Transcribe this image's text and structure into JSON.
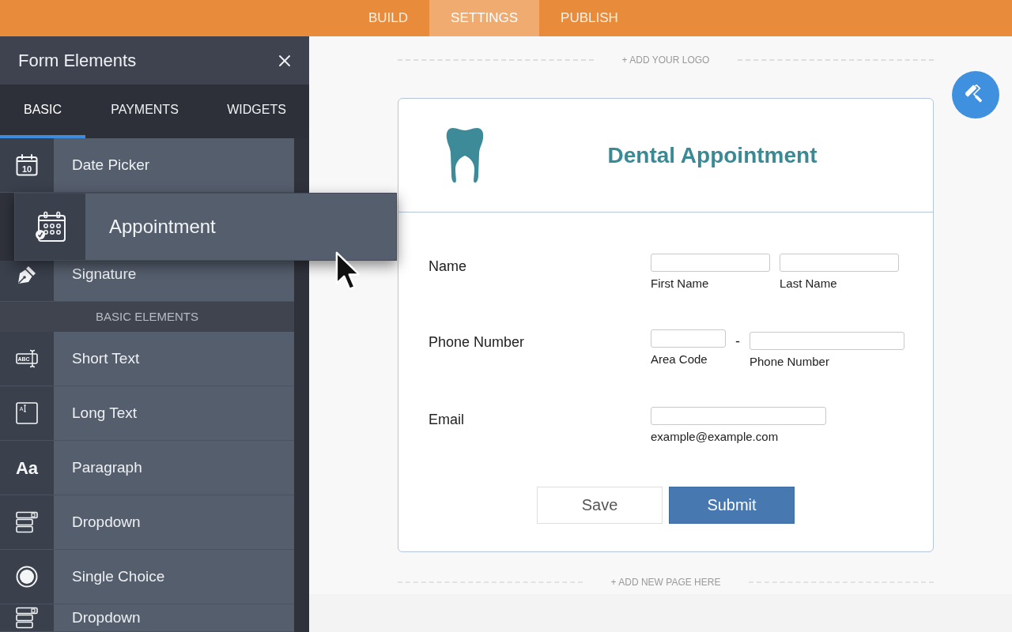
{
  "top_nav": {
    "tabs": [
      {
        "label": "BUILD",
        "selected": false
      },
      {
        "label": "SETTINGS",
        "selected": true
      },
      {
        "label": "PUBLISH",
        "selected": false
      }
    ]
  },
  "sidebar": {
    "title": "Form Elements",
    "tabs": [
      {
        "label": "BASIC",
        "selected": true
      },
      {
        "label": "PAYMENTS",
        "selected": false
      },
      {
        "label": "WIDGETS",
        "selected": false
      }
    ],
    "items": [
      {
        "kind": "element",
        "label": "Date Picker",
        "icon_text": "10"
      },
      {
        "kind": "dragging",
        "label": "Appointment"
      },
      {
        "kind": "element",
        "label": "Signature"
      },
      {
        "kind": "section",
        "label": "BASIC ELEMENTS"
      },
      {
        "kind": "element",
        "label": "Short Text",
        "icon_text": "ABC"
      },
      {
        "kind": "element",
        "label": "Long Text",
        "icon_text": "A"
      },
      {
        "kind": "element",
        "label": "Paragraph",
        "icon_text": "Aa"
      },
      {
        "kind": "element",
        "label": "Dropdown"
      },
      {
        "kind": "element",
        "label": "Single Choice"
      },
      {
        "kind": "element",
        "label": "Dropdown"
      }
    ]
  },
  "canvas": {
    "logo_placeholder": "+ ADD YOUR LOGO",
    "form": {
      "title": "Dental Appointment",
      "fields": [
        {
          "kind": "name",
          "label": "Name",
          "inputs": [
            {
              "sublabel": "First Name"
            },
            {
              "sublabel": "Last Name"
            }
          ]
        },
        {
          "kind": "phone",
          "label": "Phone Number",
          "separator": "-",
          "inputs": [
            {
              "sublabel": "Area Code"
            },
            {
              "sublabel": "Phone Number"
            }
          ]
        },
        {
          "kind": "email",
          "label": "Email",
          "inputs": [
            {
              "sublabel": "example@example.com"
            }
          ]
        }
      ],
      "buttons": [
        {
          "kind": "secondary",
          "label": "Save"
        },
        {
          "kind": "primary",
          "label": "Submit"
        }
      ]
    },
    "add_page": "+ ADD NEW PAGE HERE"
  }
}
